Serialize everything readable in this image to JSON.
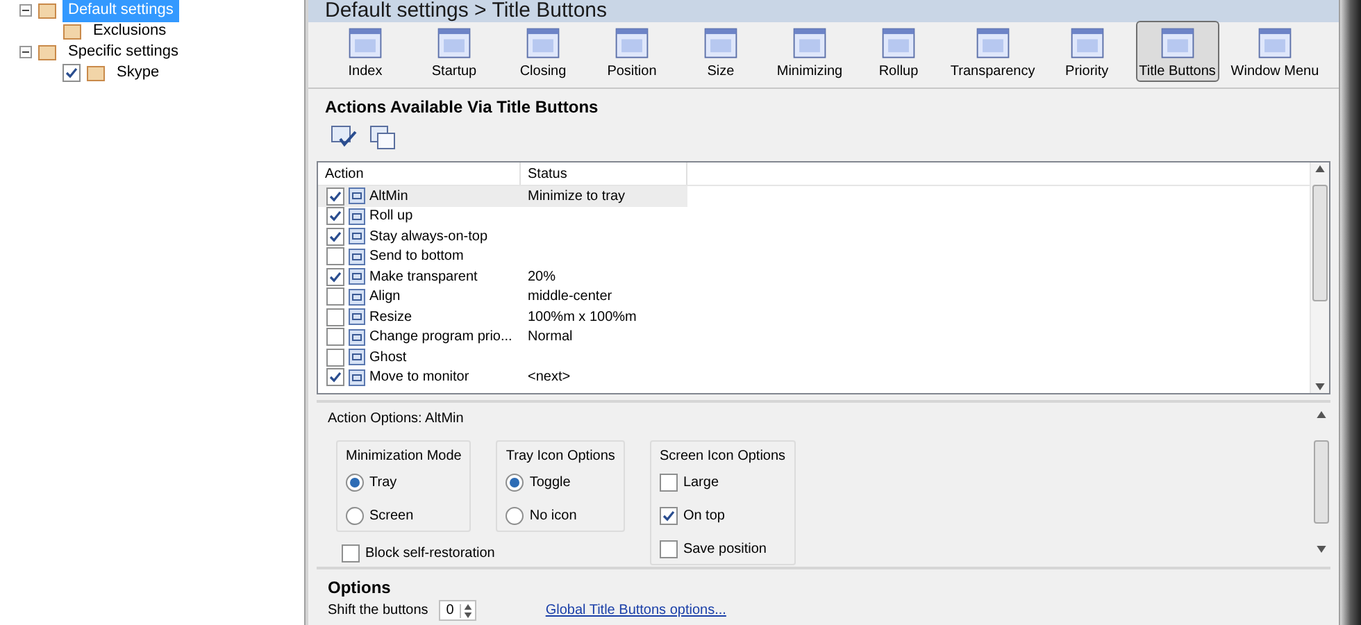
{
  "tree": [
    {
      "label": "Default settings",
      "selected": true,
      "expanded": true,
      "children": [
        {
          "label": "Exclusions",
          "selected": false
        }
      ]
    },
    {
      "label": "Specific settings",
      "selected": false,
      "expanded": true,
      "children": [
        {
          "label": "Skype",
          "selected": false,
          "checked": true
        }
      ]
    }
  ],
  "header": {
    "title": "Default settings > Title Buttons"
  },
  "toolbar": [
    {
      "label": "Index",
      "selected": false
    },
    {
      "label": "Startup",
      "selected": false
    },
    {
      "label": "Closing",
      "selected": false
    },
    {
      "label": "Position",
      "selected": false
    },
    {
      "label": "Size",
      "selected": false
    },
    {
      "label": "Minimizing",
      "selected": false
    },
    {
      "label": "Rollup",
      "selected": false
    },
    {
      "label": "Transparency",
      "selected": false
    },
    {
      "label": "Priority",
      "selected": false
    },
    {
      "label": "Title Buttons",
      "selected": true
    },
    {
      "label": "Window Menu",
      "selected": false
    }
  ],
  "actions_section": {
    "title": "Actions Available Via Title Buttons",
    "columns": [
      "Action",
      "Status"
    ],
    "rows": [
      {
        "action": "AltMin",
        "status": "Minimize to tray",
        "checked": true,
        "selected": true
      },
      {
        "action": "Roll up",
        "checked": true,
        "selected": false
      },
      {
        "action": "Stay always-on-top",
        "checked": true,
        "selected": false
      },
      {
        "action": "Send to bottom",
        "checked": false,
        "selected": false
      },
      {
        "action": "Make transparent",
        "status": "20%",
        "checked": true,
        "selected": false
      },
      {
        "action": "Align",
        "status": "middle-center",
        "checked": false,
        "selected": false
      },
      {
        "action": "Resize",
        "status": "100%m x 100%m",
        "checked": false,
        "selected": false
      },
      {
        "action": "Change program prio...",
        "status": "Normal",
        "checked": false,
        "selected": false
      },
      {
        "action": "Ghost",
        "checked": false,
        "selected": false
      },
      {
        "action": "Move to monitor",
        "status": "<next>",
        "checked": true,
        "selected": false
      }
    ]
  },
  "action_options": {
    "title": "Action Options: AltMin",
    "groups": [
      {
        "title": "Minimization Mode",
        "kind": "radio",
        "items": [
          {
            "label": "Tray",
            "selected": true
          },
          {
            "label": "Screen",
            "selected": false
          }
        ]
      },
      {
        "title": "Tray Icon Options",
        "kind": "radio",
        "items": [
          {
            "label": "Toggle",
            "selected": true
          },
          {
            "label": "No icon",
            "selected": false
          }
        ]
      },
      {
        "title": "Screen Icon Options",
        "kind": "checkbox",
        "items": [
          {
            "label": "Large",
            "checked": false
          },
          {
            "label": "On top",
            "checked": true
          },
          {
            "label": "Save position",
            "checked": false
          }
        ]
      }
    ],
    "block_self_restoration": {
      "label": "Block self-restoration",
      "checked": false
    }
  },
  "options": {
    "title": "Options",
    "shift_label": "Shift the buttons",
    "shift_value": "0",
    "link": "Global Title Buttons options..."
  }
}
